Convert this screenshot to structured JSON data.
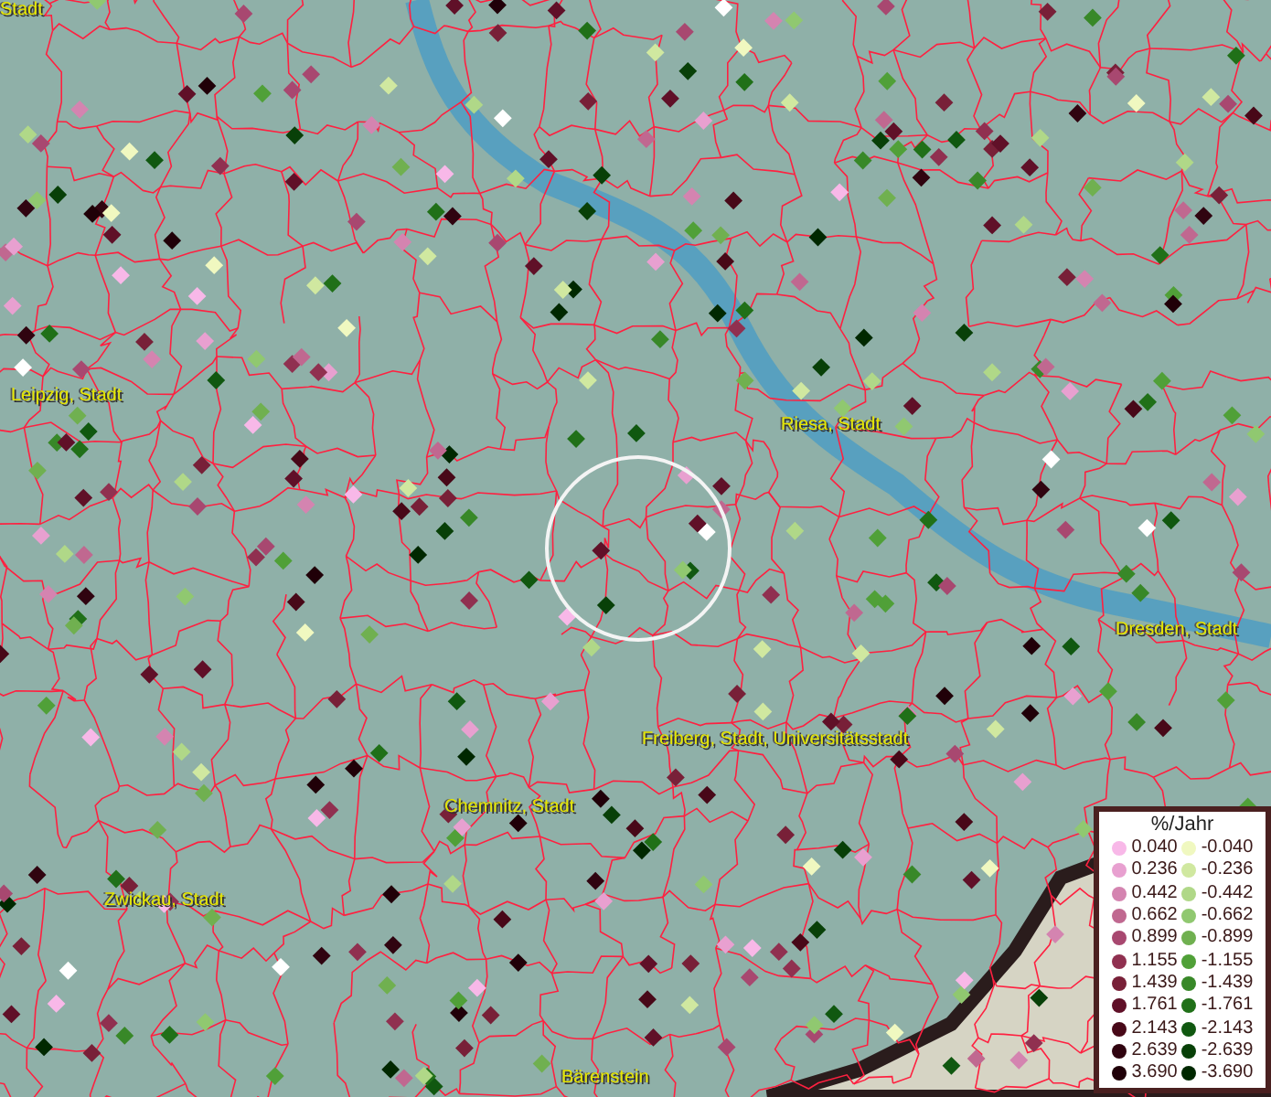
{
  "map": {
    "places": [
      {
        "name": "Stadt"
      },
      {
        "name": "Leipzig, Stadt"
      },
      {
        "name": "Riesa, Stadt"
      },
      {
        "name": "Dresden, Stadt"
      },
      {
        "name": "Freiberg, Stadt, Universitätsstadt"
      },
      {
        "name": "Chemnitz, Stadt"
      },
      {
        "name": "Zwickau, Stadt"
      },
      {
        "name": "Bärenstein"
      }
    ]
  },
  "legend": {
    "title": "%/Jahr",
    "positive": [
      {
        "label": "0.040",
        "color": "#f8b8e8"
      },
      {
        "label": "0.236",
        "color": "#e8a0d0"
      },
      {
        "label": "0.442",
        "color": "#d484b0"
      },
      {
        "label": "0.662",
        "color": "#c06890"
      },
      {
        "label": "0.899",
        "color": "#a84870"
      },
      {
        "label": "1.155",
        "color": "#903050"
      },
      {
        "label": "1.439",
        "color": "#782038"
      },
      {
        "label": "1.761",
        "color": "#601028"
      },
      {
        "label": "2.143",
        "color": "#480818"
      },
      {
        "label": "2.639",
        "color": "#300410"
      },
      {
        "label": "3.690",
        "color": "#200008"
      }
    ],
    "negative": [
      {
        "label": "-0.040",
        "color": "#f0f8c0"
      },
      {
        "label": "-0.236",
        "color": "#d0e8a0"
      },
      {
        "label": "-0.442",
        "color": "#b0d888"
      },
      {
        "label": "-0.662",
        "color": "#90c870"
      },
      {
        "label": "-0.899",
        "color": "#70b050"
      },
      {
        "label": "-1.155",
        "color": "#50a038"
      },
      {
        "label": "-1.439",
        "color": "#388828"
      },
      {
        "label": "-1.761",
        "color": "#207018"
      },
      {
        "label": "-2.143",
        "color": "#105810"
      },
      {
        "label": "-2.639",
        "color": "#084008"
      },
      {
        "label": "-3.690",
        "color": "#002800"
      }
    ]
  }
}
